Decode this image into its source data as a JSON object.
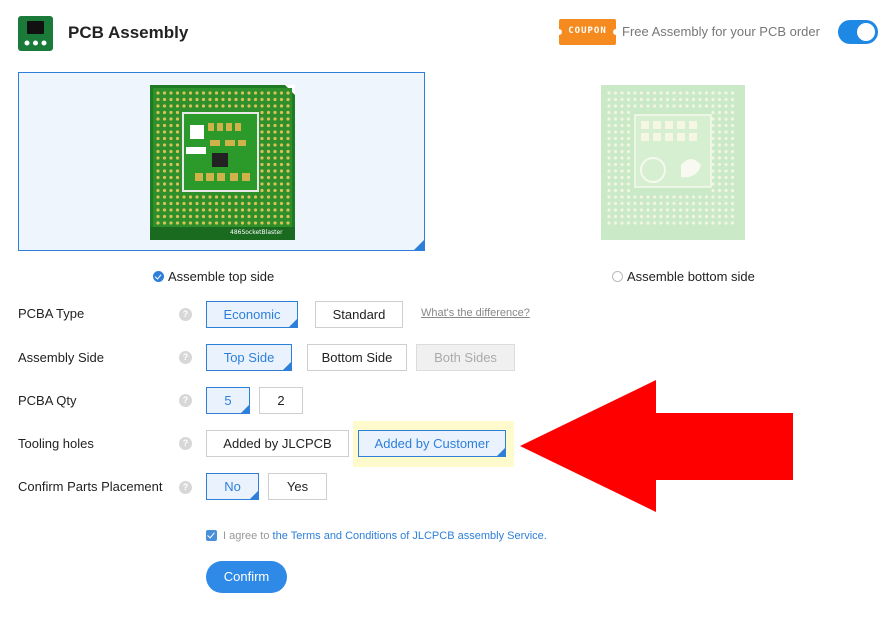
{
  "header": {
    "title": "PCB Assembly",
    "coupon_label": "COUPON",
    "free_assembly_text": "Free Assembly for your PCB order",
    "toggle_on": true,
    "accent_color": "#2e7fd9",
    "coupon_color": "#f58a1f"
  },
  "boards": {
    "top_silkscreen": "486SocketBlaster",
    "top_option": "Assemble top side",
    "bottom_option": "Assemble bottom side",
    "selected": "top"
  },
  "form": {
    "pcba_type": {
      "label": "PCBA Type",
      "options": [
        "Economic",
        "Standard"
      ],
      "selected": "Economic",
      "link": "What's the difference?"
    },
    "assembly_side": {
      "label": "Assembly Side",
      "options": [
        "Top Side",
        "Bottom Side",
        "Both Sides"
      ],
      "selected": "Top Side",
      "disabled": "Both Sides"
    },
    "pcba_qty": {
      "label": "PCBA Qty",
      "options": [
        "5",
        "2"
      ],
      "selected": "5"
    },
    "tooling_holes": {
      "label": "Tooling holes",
      "options": [
        "Added by JLCPCB",
        "Added by Customer"
      ],
      "selected": "Added by Customer"
    },
    "confirm_parts": {
      "label": "Confirm Parts Placement",
      "options": [
        "No",
        "Yes"
      ],
      "selected": "No"
    },
    "help_glyph": "?"
  },
  "agreement": {
    "checked": true,
    "prefix": "I agree to",
    "link": "the Terms and Conditions of JLCPCB assembly Service."
  },
  "confirm_label": "Confirm",
  "annotation": {
    "arrow_color": "#ff0000",
    "highlight_color": "#fffbcc"
  }
}
